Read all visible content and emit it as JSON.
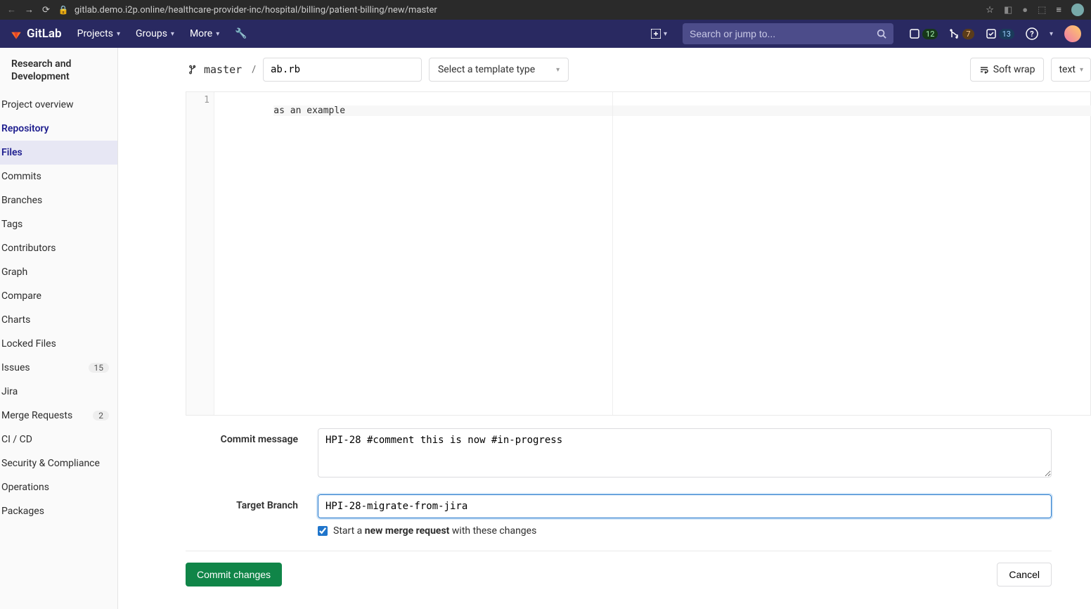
{
  "browser": {
    "url": "gitlab.demo.i2p.online/healthcare-provider-inc/hospital/billing/patient-billing/new/master"
  },
  "topnav": {
    "brand": "GitLab",
    "links": {
      "projects": "Projects",
      "groups": "Groups",
      "more": "More"
    },
    "search_placeholder": "Search or jump to...",
    "badges": {
      "issues": "12",
      "mrs": "7",
      "todos": "13"
    }
  },
  "sidebar": {
    "project_name": "Research and Development",
    "items": [
      {
        "label": "Project overview"
      },
      {
        "label": "Repository"
      },
      {
        "label": "Files"
      },
      {
        "label": "Commits"
      },
      {
        "label": "Branches"
      },
      {
        "label": "Tags"
      },
      {
        "label": "Contributors"
      },
      {
        "label": "Graph"
      },
      {
        "label": "Compare"
      },
      {
        "label": "Charts"
      },
      {
        "label": "Locked Files"
      },
      {
        "label": "Issues",
        "count": "15"
      },
      {
        "label": "Jira"
      },
      {
        "label": "Merge Requests",
        "count": "2"
      },
      {
        "label": "CI / CD"
      },
      {
        "label": "Security & Compliance"
      },
      {
        "label": "Operations"
      },
      {
        "label": "Packages"
      }
    ]
  },
  "editor": {
    "branch": "master",
    "filename": "ab.rb",
    "template_label": "Select a template type",
    "softwrap_label": "Soft wrap",
    "mode_label": "text",
    "line_number": "1",
    "code": "as an example"
  },
  "form": {
    "commit_label": "Commit message",
    "commit_value": "HPI-28 #comment this is now #in-progress",
    "target_label": "Target Branch",
    "target_value": "HPI-28-migrate-from-jira",
    "mr_prefix": "Start a ",
    "mr_bold": "new merge request",
    "mr_suffix": " with these changes",
    "commit_btn": "Commit changes",
    "cancel_btn": "Cancel"
  }
}
